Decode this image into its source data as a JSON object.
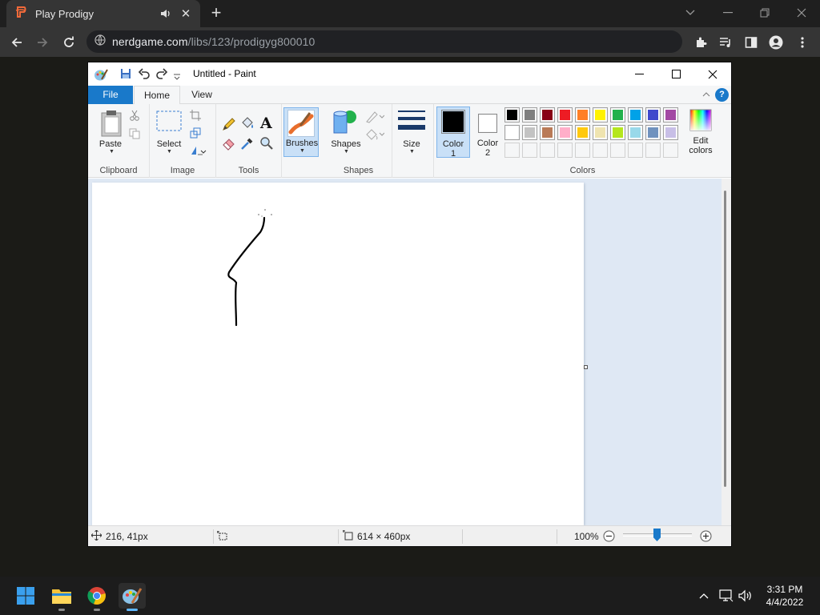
{
  "browser": {
    "tab_title": "Play Prodigy",
    "url_host": "nerdgame.com",
    "url_path": "/libs/123/prodigyg800010"
  },
  "paint": {
    "window_title": "Untitled - Paint",
    "tabs": {
      "file": "File",
      "home": "Home",
      "view": "View"
    },
    "help": "?",
    "groups": {
      "clipboard": "Clipboard",
      "image": "Image",
      "tools": "Tools",
      "shapes": "Shapes",
      "colors": "Colors"
    },
    "buttons": {
      "paste": "Paste",
      "select": "Select",
      "brushes": "Brushes",
      "shapes": "Shapes",
      "size": "Size",
      "color1_line1": "Color",
      "color1_line2": "1",
      "color2_line1": "Color",
      "color2_line2": "2",
      "edit_colors_line1": "Edit",
      "edit_colors_line2": "colors"
    },
    "palette_row1": [
      "#000000",
      "#7f7f7f",
      "#880015",
      "#ed1c24",
      "#ff7f27",
      "#fff200",
      "#22b14c",
      "#00a2e8",
      "#3f48cc",
      "#a349a4"
    ],
    "palette_row2": [
      "#ffffff",
      "#c3c3c3",
      "#b97a57",
      "#ffaec9",
      "#ffc90e",
      "#efe4b0",
      "#b5e61d",
      "#99d9ea",
      "#7092be",
      "#c8bfe7"
    ],
    "color1": "#000000",
    "color2": "#ffffff",
    "status": {
      "cursor_pos": "216, 41px",
      "canvas_size": "614 × 460px",
      "zoom": "100%"
    }
  },
  "taskbar": {
    "time": "3:31 PM",
    "date": "4/4/2022"
  }
}
